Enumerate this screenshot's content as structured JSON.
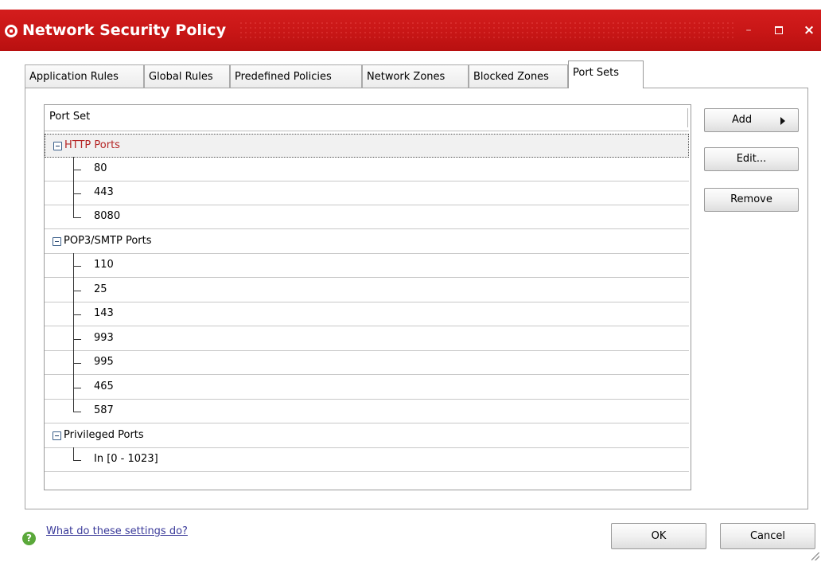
{
  "window": {
    "title": "Network Security Policy",
    "minimize": "–",
    "close": "×",
    "accent": "#d11a1a"
  },
  "tabs": [
    {
      "label": "Application Rules",
      "active": false
    },
    {
      "label": "Global Rules",
      "active": false
    },
    {
      "label": "Predefined Policies",
      "active": false
    },
    {
      "label": "Network Zones",
      "active": false
    },
    {
      "label": "Blocked Zones",
      "active": false
    },
    {
      "label": "Port Sets",
      "active": true
    }
  ],
  "list": {
    "header": "Port Set",
    "groups": [
      {
        "name": "HTTP Ports",
        "expanded": true,
        "selected": true,
        "ports": [
          "80",
          "443",
          "8080"
        ]
      },
      {
        "name": "POP3/SMTP Ports",
        "expanded": true,
        "selected": false,
        "ports": [
          "110",
          "25",
          "143",
          "993",
          "995",
          "465",
          "587"
        ]
      },
      {
        "name": "Privileged Ports",
        "expanded": true,
        "selected": false,
        "ports": [
          "In [0 - 1023]"
        ]
      }
    ]
  },
  "buttons": {
    "add": "Add",
    "edit": "Edit...",
    "remove": "Remove",
    "ok": "OK",
    "cancel": "Cancel"
  },
  "help": {
    "icon": "?",
    "link": "What do these settings do?"
  }
}
